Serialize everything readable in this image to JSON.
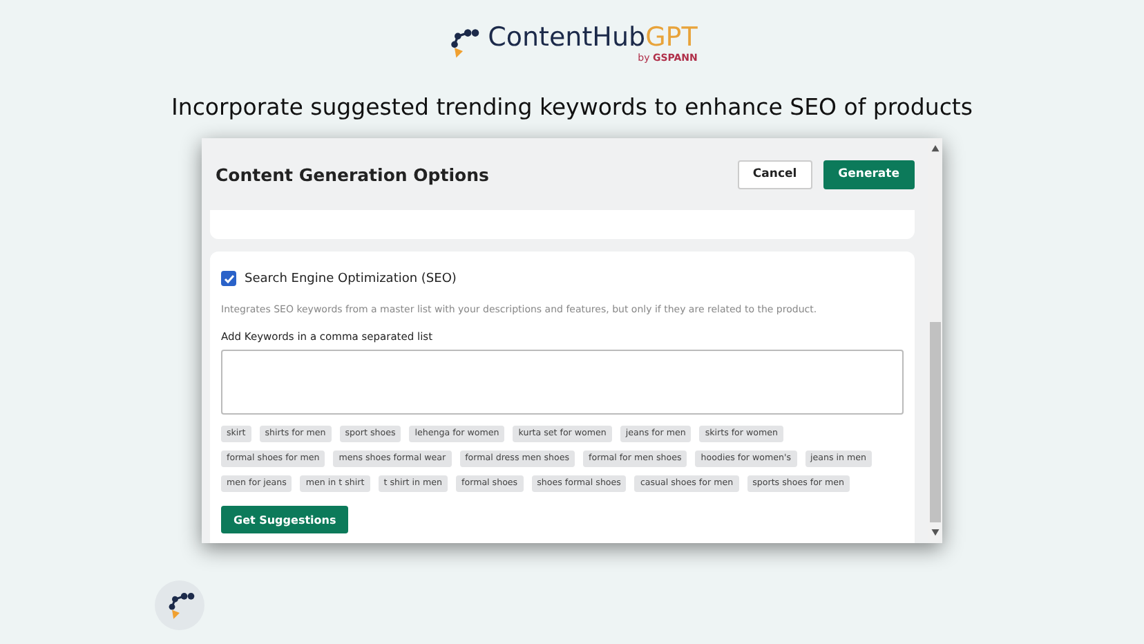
{
  "brand": {
    "name": "ContentHub",
    "name_accent": "GPT",
    "byline_prefix": "by",
    "byline_company": "GSPANN"
  },
  "headline": "Incorporate suggested trending keywords to enhance SEO of products",
  "dialog": {
    "title": "Content Generation Options",
    "buttons": [
      {
        "label": "Cancel",
        "kind": "secondary"
      },
      {
        "label": "Generate",
        "kind": "primary"
      }
    ],
    "seo": {
      "label": "Search Engine Optimization (SEO)",
      "checked": true,
      "description": "Integrates SEO keywords from a master list with your descriptions and features, but only if they are related to the product.",
      "field_label": "Add Keywords in a comma separated list",
      "suggestions": [
        "skirt",
        "shirts for men",
        "sport shoes",
        "lehenga for women",
        "kurta set for women",
        "jeans for men",
        "skirts for women",
        "formal shoes for men",
        "mens shoes formal wear",
        "formal dress men shoes",
        "formal for men shoes",
        "hoodies for women's",
        "jeans in men",
        "men for jeans",
        "men in t shirt",
        "t shirt in men",
        "formal shoes",
        "shoes formal shoes",
        "casual shoes for men",
        "sports shoes for men"
      ],
      "action": "Get Suggestions"
    }
  }
}
